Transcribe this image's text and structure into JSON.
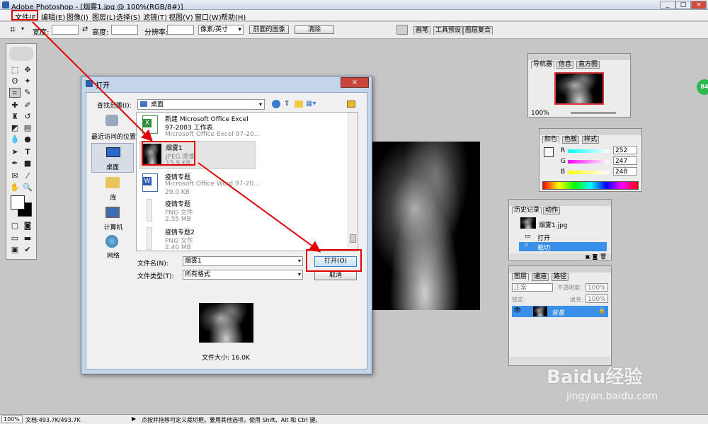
{
  "app": {
    "title": "Adobe Photoshop - [烟雾1.jpg @ 100%(RGB/8#)]",
    "window_controls": [
      "_",
      "□",
      "×"
    ]
  },
  "menu": [
    "文件(F)",
    "编辑(E)",
    "图像(I)",
    "图层(L)",
    "选择(S)",
    "滤镜(T)",
    "视图(V)",
    "窗口(W)",
    "帮助(H)"
  ],
  "options_bar": {
    "width_label": "宽度:",
    "height_label": "高度:",
    "resolution_label": "分辨率:",
    "unit_value": "像素/英寸",
    "front_image_btn": "前面的图像",
    "clear_btn": "清除",
    "tabs": [
      "画笔",
      "工具预设",
      "图层复合"
    ]
  },
  "navigator": {
    "tabs": [
      "导航器",
      "信息",
      "直方图"
    ],
    "zoom": "100%"
  },
  "color_panel": {
    "tabs": [
      "颜色",
      "色板",
      "样式"
    ],
    "r_label": "R",
    "g_label": "G",
    "b_label": "B",
    "r": "252",
    "g": "247",
    "b": "248"
  },
  "history_panel": {
    "tabs": [
      "历史记录",
      "动作"
    ],
    "snapshot": "烟雾1.jpg",
    "items": [
      "打开",
      "裁切"
    ]
  },
  "layers_panel": {
    "tabs": [
      "图层",
      "通道",
      "路径"
    ],
    "blend_mode": "正常",
    "opacity_label": "不透明度:",
    "opacity": "100%",
    "lock_label": "锁定:",
    "fill_label": "填充:",
    "fill": "100%",
    "layer_name": "背景"
  },
  "dialog": {
    "title": "打开",
    "look_in_label": "查找范围(I):",
    "look_in_value": "桌面",
    "places": [
      "最近访问的位置",
      "桌面",
      "库",
      "计算机",
      "网络"
    ],
    "files": [
      {
        "name": "新建 Microsoft Office Excel 97-2003 工作表",
        "line1": "新建 Microsoft Office Excel",
        "line2": "97-2003 工作表",
        "type": "Microsoft Office Excel 97-20..."
      },
      {
        "name": "烟雾1",
        "type": "JPEG 图像",
        "size": "15.9 KB"
      },
      {
        "name": "疫情专题",
        "type": "Microsoft Office Word 97-20...",
        "size": "29.0 KB"
      },
      {
        "name": "疫情专题",
        "type": "PNG 文件",
        "size": "2.55 MB"
      },
      {
        "name": "疫情专题2",
        "type": "PNG 文件",
        "size": "2.40 MB"
      }
    ],
    "filename_label": "文件名(N):",
    "filename_value": "烟雾1",
    "filetype_label": "文件类型(T):",
    "filetype_value": "所有格式",
    "open_btn": "打开(O)",
    "cancel_btn": "取消",
    "file_size": "文件大小: 16.0K"
  },
  "status_bar": {
    "zoom": "100%",
    "doc": "文档:493.7K/493.7K",
    "hint": "点按并拖移可定义裁切框。要用其他选项，使用 Shift、Alt 和 Ctrl 键。"
  },
  "watermark": {
    "brand": "Baidu经验",
    "url": "jingyan.baidu.com"
  },
  "badge": "84"
}
